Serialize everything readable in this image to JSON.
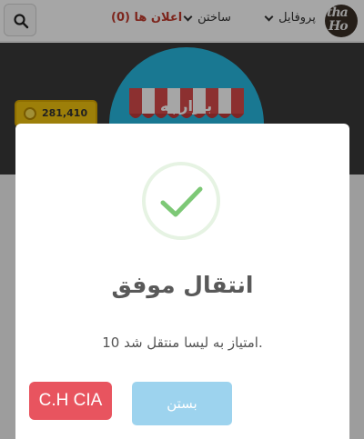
{
  "nav": {
    "ads": "اعلان ها (0)",
    "build": "ساختن",
    "profile": "پروفایل",
    "avatar_line1": "tha",
    "avatar_line2": "Ho"
  },
  "banner": {
    "title": "بازارچه",
    "coins": "281,410"
  },
  "dialog": {
    "title": "انتقال موفق",
    "text": "10 امتیاز به لیسا منتقل شد.",
    "close_label": "بستن",
    "brand_label": "C.H CIA"
  },
  "colors": {
    "success": "#7dc876",
    "close_button": "#9dd3ee",
    "brand_button": "#e8545f",
    "ads_text": "#c0392b"
  },
  "icons": [
    "search-icon",
    "chevron-down-icon",
    "coin-icon",
    "shop-awning-icon",
    "check-icon"
  ]
}
